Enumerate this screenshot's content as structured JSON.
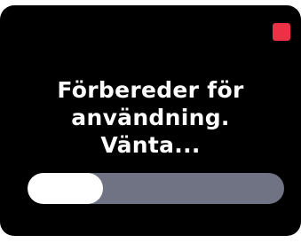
{
  "message": {
    "lines": [
      "Förbereder för",
      "användning.",
      "Vänta..."
    ]
  },
  "progress": {
    "fraction": 0.295
  },
  "colors": {
    "background": "#000000",
    "text": "#ffffff",
    "indicator": "#ec3147",
    "track": "#707384",
    "fill": "#ffffff"
  },
  "icons": {
    "status_indicator": "red-square-indicator"
  }
}
